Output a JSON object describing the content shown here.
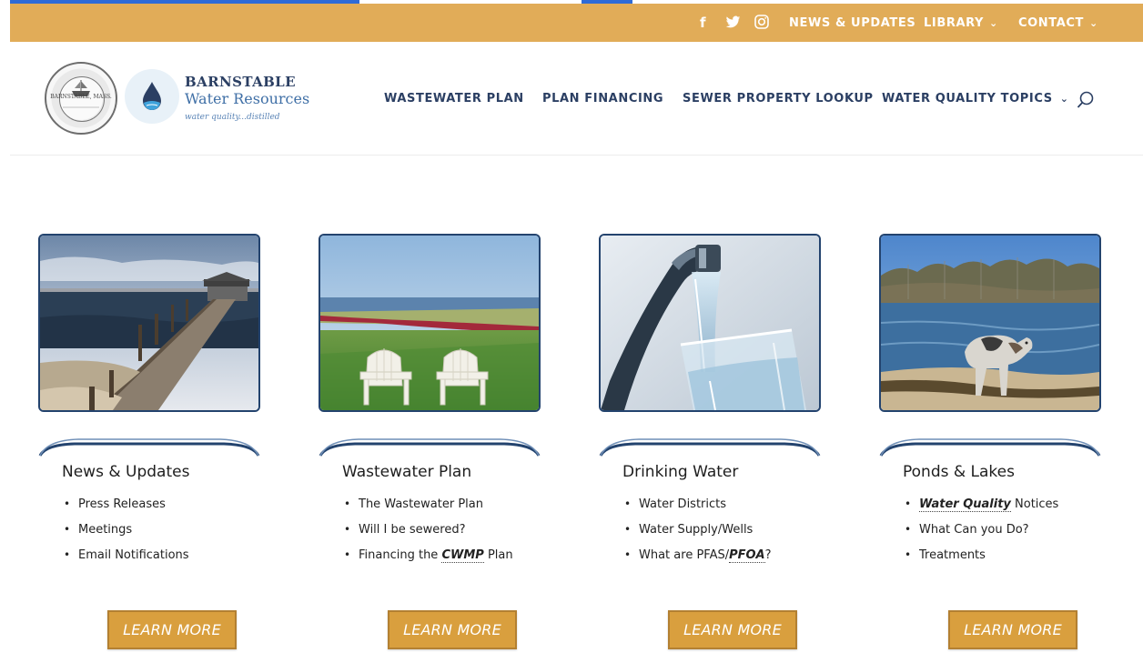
{
  "topbar": {
    "social": [
      {
        "icon": "facebook-icon",
        "glyph": "f"
      },
      {
        "icon": "twitter-icon",
        "glyph": "🐦"
      },
      {
        "icon": "instagram-icon",
        "glyph": "◎"
      }
    ],
    "links": [
      {
        "label": "NEWS & UPDATES",
        "dropdown": false
      },
      {
        "label": "LIBRARY",
        "dropdown": true
      },
      {
        "label": "CONTACT",
        "dropdown": true
      }
    ],
    "bg_color": "#e1ac58"
  },
  "brand": {
    "seal_text": "BARNSTABLE, MASS.",
    "line1": "BARNSTABLE",
    "line2": "Water Resources",
    "tagline": "water quality...distilled"
  },
  "nav": {
    "items": [
      {
        "label": "WASTEWATER PLAN",
        "dropdown": false
      },
      {
        "label": "PLAN FINANCING",
        "dropdown": false
      },
      {
        "label": "SEWER PROPERTY LOOKUP",
        "dropdown": false
      },
      {
        "label": "WATER QUALITY TOPICS",
        "dropdown": true
      }
    ],
    "search_icon": "search-icon",
    "text_color": "#2b3f63"
  },
  "cards": [
    {
      "title": "News & Updates",
      "image": "harbor-pier-photo",
      "items": [
        "Press Releases",
        "Meetings",
        "Email Notifications"
      ],
      "button": "LEARN MORE"
    },
    {
      "title": "Wastewater Plan",
      "image": "lawn-chairs-photo",
      "items": [
        "The Wastewater Plan",
        "Will I be sewered?",
        "Financing the CWMP Plan"
      ],
      "item3_prefix": "Financing the ",
      "item3_abbr": "CWMP",
      "item3_suffix": " Plan",
      "button": "LEARN MORE"
    },
    {
      "title": "Drinking Water",
      "image": "faucet-glass-photo",
      "items": [
        "Water Districts",
        "Water Supply/Wells",
        "What are PFAS/PFOA?"
      ],
      "item3_prefix": "What are PFAS/",
      "item3_abbr": "PFOA",
      "item3_suffix": "?",
      "button": "LEARN MORE"
    },
    {
      "title": "Ponds & Lakes",
      "image": "dog-pond-photo",
      "items": [
        "Water Quality Notices",
        "What Can you Do?",
        "Treatments"
      ],
      "item1_abbr": "Water Quality",
      "item1_suffix": " Notices",
      "button": "LEARN MORE"
    }
  ],
  "colors": {
    "accent": "#d99f3e",
    "navy": "#23436e"
  }
}
